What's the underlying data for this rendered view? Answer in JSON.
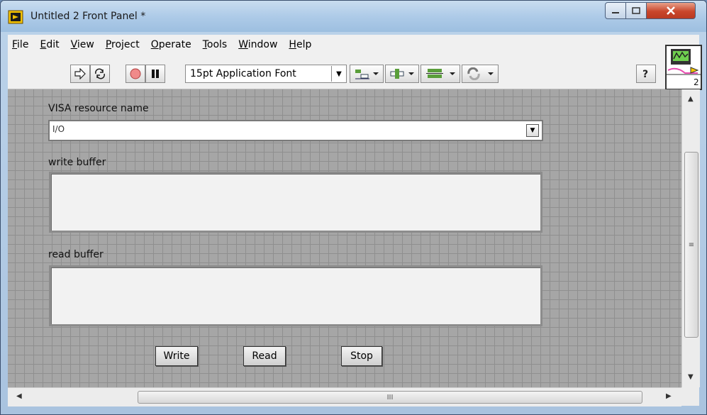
{
  "window": {
    "title": "Untitled 2 Front Panel *"
  },
  "menu": [
    {
      "label": "File",
      "accel": "F",
      "rest": "ile"
    },
    {
      "label": "Edit",
      "accel": "E",
      "rest": "dit"
    },
    {
      "label": "View",
      "accel": "V",
      "rest": "iew"
    },
    {
      "label": "Project",
      "accel": "P",
      "rest": "roject"
    },
    {
      "label": "Operate",
      "accel": "O",
      "rest": "perate"
    },
    {
      "label": "Tools",
      "accel": "T",
      "rest": "ools"
    },
    {
      "label": "Window",
      "accel": "W",
      "rest": "indow"
    },
    {
      "label": "Help",
      "accel": "H",
      "rest": "elp"
    }
  ],
  "toolbar": {
    "font": "15pt Application Font"
  },
  "connector": {
    "number": "2"
  },
  "panel": {
    "visa_label": "VISA resource name",
    "visa_prefix": "I/O",
    "write_label": "write buffer",
    "read_label": "read buffer",
    "buttons": {
      "write": "Write",
      "read": "Read",
      "stop": "Stop"
    }
  },
  "scroll": {
    "grip": "III",
    "vgrip": "≡"
  },
  "colors": {
    "panel_bg": "#a6a6a6",
    "grid": "#8f8f8f",
    "close": "#c9462c"
  }
}
